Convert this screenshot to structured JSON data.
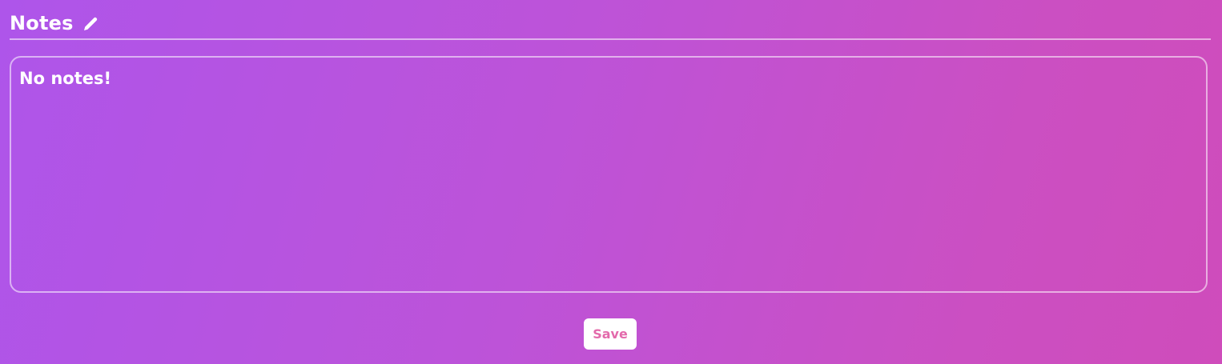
{
  "header": {
    "title": "Notes",
    "edit_icon": "pencil-icon"
  },
  "notes": {
    "value": "No notes!"
  },
  "actions": {
    "save_label": "Save"
  },
  "colors": {
    "background_start": "#ae55ea",
    "background_end": "#cf4cbb",
    "save_text": "#e36aab",
    "text": "#ffffff"
  }
}
